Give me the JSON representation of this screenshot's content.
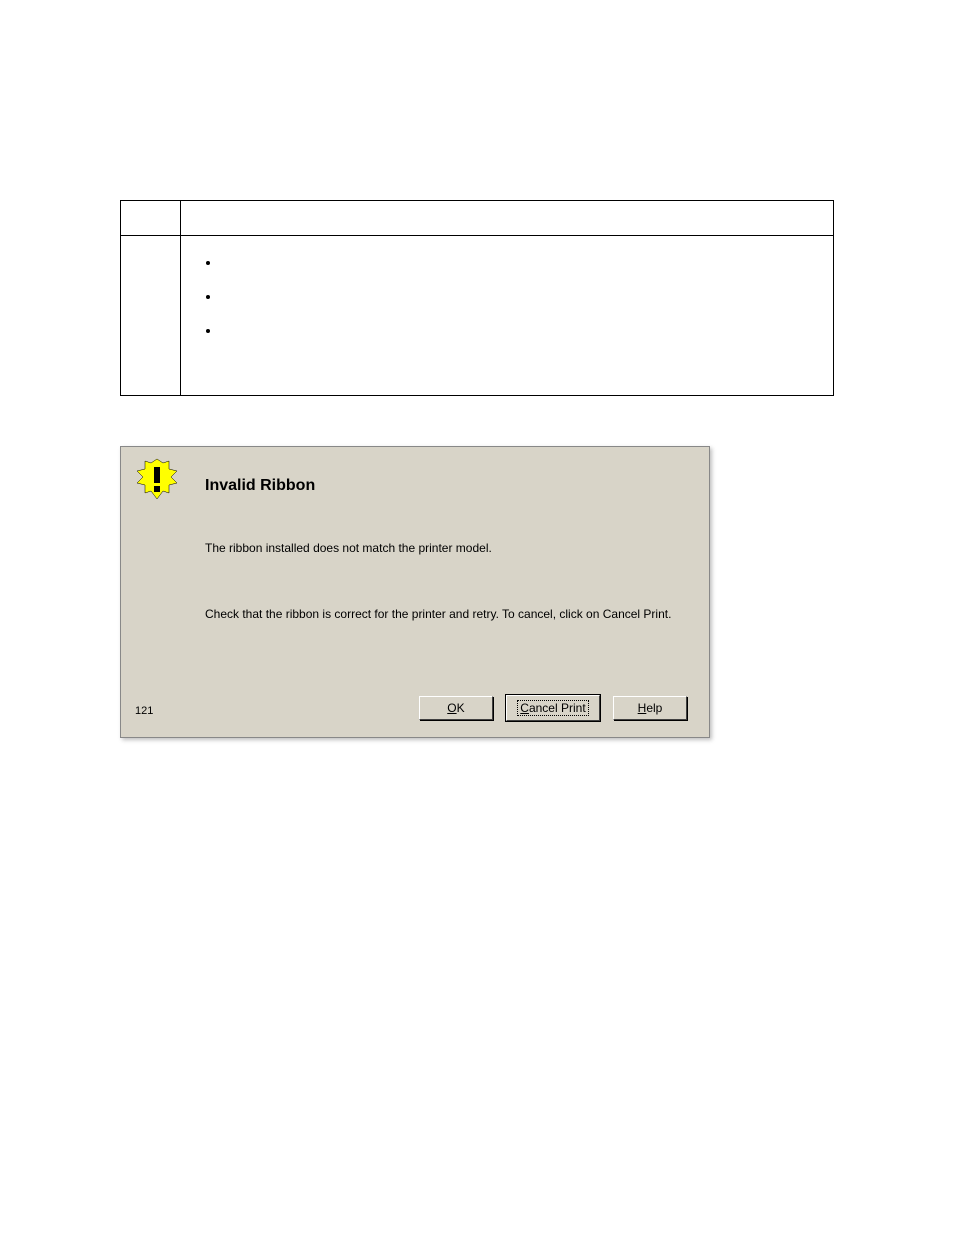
{
  "dialog": {
    "title": "Invalid Ribbon",
    "message1": "The ribbon installed does not match the printer model.",
    "message2": "Check that the ribbon is correct for the printer and retry. To cancel, click on Cancel Print.",
    "code": "121",
    "buttons": {
      "ok_u": "O",
      "ok_rest": "K",
      "cancel_u": "C",
      "cancel_rest": "ancel Print",
      "help_u": "H",
      "help_rest": "elp"
    }
  }
}
